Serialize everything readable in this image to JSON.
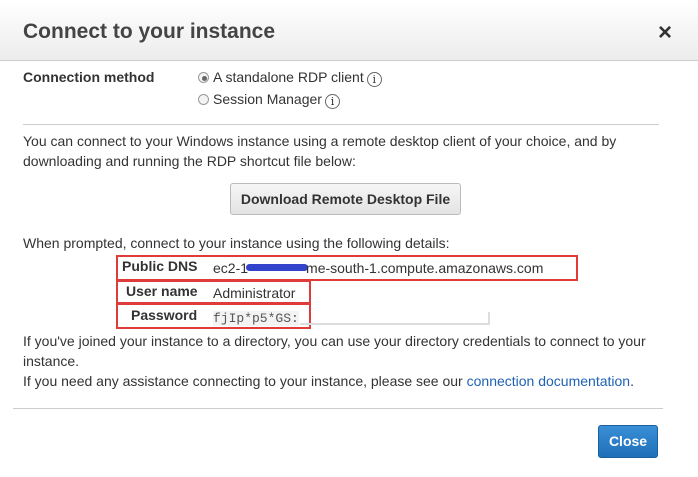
{
  "dialog": {
    "title": "Connect to your instance",
    "close_icon": "×"
  },
  "connection": {
    "label": "Connection method",
    "options": [
      {
        "label": "A standalone RDP client",
        "selected": true
      },
      {
        "label": "Session Manager",
        "selected": false
      }
    ],
    "info_icon": "i"
  },
  "intro": "You can connect to your Windows instance using a remote desktop client of your choice, and by downloading and running the RDP shortcut file below:",
  "download_label": "Download Remote Desktop File",
  "prompt": "When prompted, connect to your instance using the following details:",
  "details": {
    "dns_label": "Public DNS",
    "dns_prefix": "ec2-1",
    "dns_suffix": "me-south-1.compute.amazonaws.com",
    "user_label": "User name",
    "user_value": "Administrator",
    "password_label": "Password",
    "password_value": "fjIp*p5*GS:"
  },
  "directory_note": "If you've joined your instance to a directory, you can use your directory credentials to connect to your instance.",
  "help_prefix": "If you need any assistance connecting to your instance, please see our",
  "help_link": "connection documentation",
  "help_suffix": ".",
  "close_label": "Close"
}
